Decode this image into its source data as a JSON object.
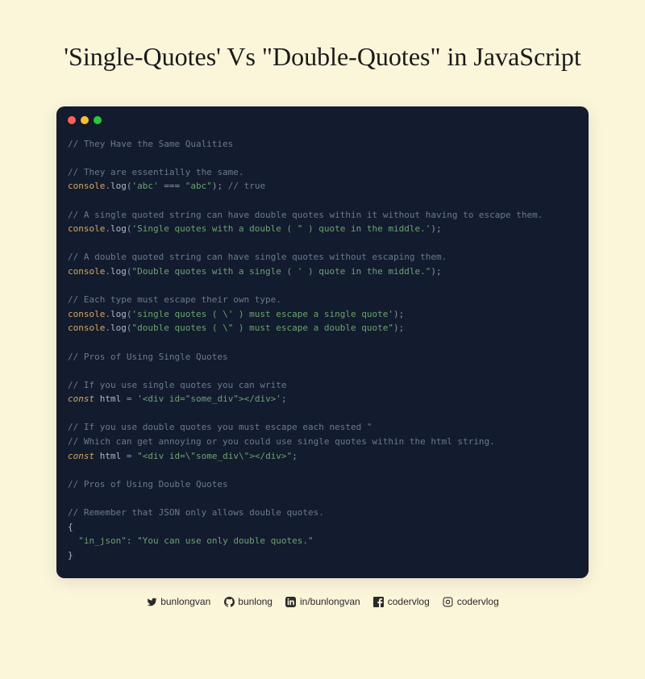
{
  "title": "'Single-Quotes' Vs \"Double-Quotes\" in JavaScript",
  "code": {
    "c1": "// They Have the Same Qualities",
    "c2": "// They are essentially the same.",
    "l1_console": "console",
    "l1_method": "log",
    "l1_arg1": "'abc'",
    "l1_op": "===",
    "l1_arg2": "\"abc\"",
    "l1_trail": "// true",
    "c3": "// A single quoted string can have double quotes within it without having to escape them.",
    "l2_arg": "'Single quotes with a double ( \" ) quote in the middle.'",
    "c4": "// A double quoted string can have single quotes without escaping them.",
    "l3_arg": "\"Double quotes with a single ( ' ) quote in the middle.\"",
    "c5": "// Each type must escape their own type.",
    "l4_arg": "'single quotes ( \\' ) must escape a single quote'",
    "l5_arg": "\"double quotes ( \\\" ) must escape a double quote\"",
    "c6": "// Pros of Using Single Quotes",
    "c7": "// If you use single quotes you can write",
    "kw_const": "const",
    "var_html": "html",
    "l6_val": "'<div id=\"some_div\"></div>'",
    "c8": "// If you use double quotes you must escape each nested \"",
    "c9": "// Which can get annoying or you could use single quotes within the html string.",
    "l7_val": "\"<div id=\\\"some_div\\\"></div>\"",
    "c10": "// Pros of Using Double Quotes",
    "c11": "// Remember that JSON only allows double quotes.",
    "json_key": "\"in_json\"",
    "json_val": "\"You can use only double quotes.\""
  },
  "socials": {
    "twitter": "bunlongvan",
    "github": "bunlong",
    "linkedin": "in/bunlongvan",
    "facebook": "codervlog",
    "instagram": "codervlog"
  }
}
